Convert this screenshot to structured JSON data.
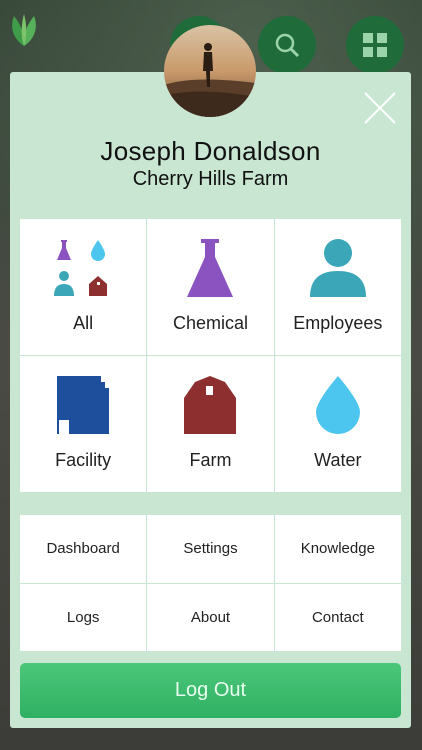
{
  "app": {
    "background_icons": [
      "leaf-logo-icon",
      "search-icon",
      "grid-icon"
    ]
  },
  "profile": {
    "name": "Joseph Donaldson",
    "farm": "Cherry Hills Farm"
  },
  "categories": [
    {
      "label": "All",
      "icon": "all-categories-icon"
    },
    {
      "label": "Chemical",
      "icon": "flask-icon"
    },
    {
      "label": "Employees",
      "icon": "person-icon"
    },
    {
      "label": "Facility",
      "icon": "facility-icon"
    },
    {
      "label": "Farm",
      "icon": "barn-icon"
    },
    {
      "label": "Water",
      "icon": "water-drop-icon"
    }
  ],
  "links": [
    {
      "label": "Dashboard"
    },
    {
      "label": "Settings"
    },
    {
      "label": "Knowledge"
    },
    {
      "label": "Logs"
    },
    {
      "label": "About"
    },
    {
      "label": "Contact"
    }
  ],
  "logout_label": "Log Out",
  "colors": {
    "modal_bg": "#c8e6d2",
    "chemical": "#8a53c0",
    "employees": "#3aa6b8",
    "facility": "#1d4f9c",
    "farm": "#8e2f2f",
    "water": "#4cc5ef",
    "logout": "#3bbb6c"
  }
}
